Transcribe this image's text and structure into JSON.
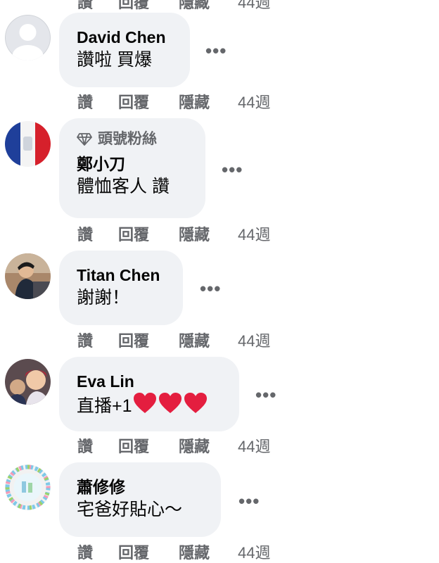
{
  "actions": {
    "like": "讚",
    "reply": "回覆",
    "hide": "隱藏",
    "time": "44週"
  },
  "comments": [
    {
      "author": "David Chen",
      "text": "讚啦 買爆"
    },
    {
      "badge": "頭號粉絲",
      "author": "鄭小刀",
      "text": "體恤客人 讚"
    },
    {
      "author": "Titan Chen",
      "text": "謝謝！"
    },
    {
      "author": "Eva Lin",
      "text": "直播+1"
    },
    {
      "author": "蕭修修",
      "text": "宅爸好貼心～"
    }
  ],
  "more_label": "•••",
  "colors": {
    "bubble": "#f0f2f5",
    "secondary_text": "#65676b",
    "heart": "#e41e3f"
  }
}
